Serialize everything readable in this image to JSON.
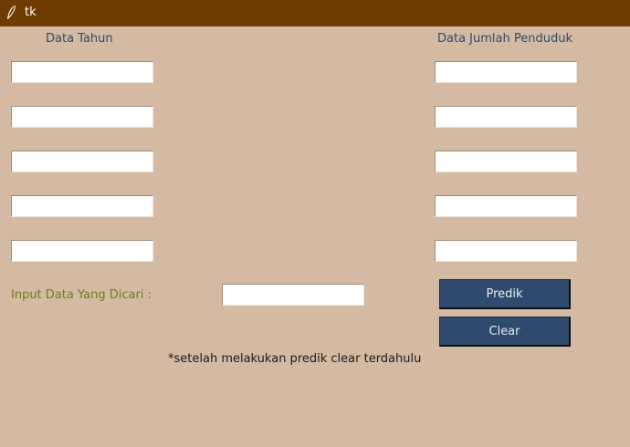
{
  "window": {
    "title": "tk",
    "icon": "feather-icon"
  },
  "labels": {
    "year_header": "Data Tahun",
    "population_header": "Data Jumlah Penduduk",
    "search_input_label": "Input Data Yang Dicari :",
    "note": "*setelah melakukan predik clear terdahulu"
  },
  "year_inputs": [
    "",
    "",
    "",
    "",
    ""
  ],
  "population_inputs": [
    "",
    "",
    "",
    "",
    ""
  ],
  "search_input": "",
  "buttons": {
    "predict": "Predik",
    "clear": "Clear"
  },
  "colors": {
    "background": "#d4baa3",
    "titlebar": "#6e3b00",
    "button": "#2f4a6e",
    "header_text": "#2f4a6e",
    "label_text": "#6b7f1e"
  }
}
